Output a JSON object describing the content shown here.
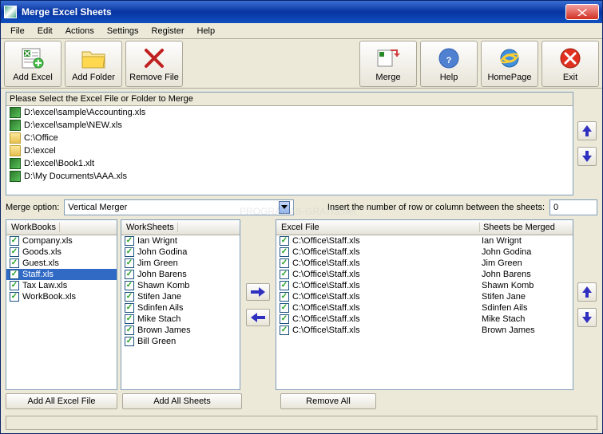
{
  "window": {
    "title": "Merge Excel Sheets"
  },
  "menu": {
    "file": "File",
    "edit": "Edit",
    "actions": "Actions",
    "settings": "Settings",
    "register": "Register",
    "help": "Help"
  },
  "toolbar": {
    "add_excel": "Add Excel",
    "add_folder": "Add Folder",
    "remove_file": "Remove File",
    "merge": "Merge",
    "help": "Help",
    "homepage": "HomePage",
    "exit": "Exit"
  },
  "filelist": {
    "header": "Please Select the Excel File or Folder to Merge",
    "items": [
      {
        "type": "excel",
        "path": "D:\\excel\\sample\\Accounting.xls"
      },
      {
        "type": "excel",
        "path": "D:\\excel\\sample\\NEW.xls"
      },
      {
        "type": "folder",
        "path": "C:\\Office"
      },
      {
        "type": "folder",
        "path": "D:\\excel"
      },
      {
        "type": "excel",
        "path": "D:\\excel\\Book1.xlt"
      },
      {
        "type": "excel",
        "path": "D:\\My Documents\\AAA.xls"
      }
    ]
  },
  "options": {
    "merge_option_label": "Merge option:",
    "merge_option_value": "Vertical Merger",
    "insert_label": "Insert the number of row or column between the sheets:",
    "insert_value": "0"
  },
  "workbooks": {
    "header": "WorkBooks",
    "items": [
      {
        "name": "Company.xls",
        "checked": true
      },
      {
        "name": "Goods.xls",
        "checked": true
      },
      {
        "name": "Guest.xls",
        "checked": true
      },
      {
        "name": "Staff.xls",
        "checked": true,
        "selected": true
      },
      {
        "name": "Tax Law.xls",
        "checked": true
      },
      {
        "name": "WorkBook.xls",
        "checked": true
      }
    ]
  },
  "worksheets": {
    "header": "WorkSheets",
    "items": [
      {
        "name": "Ian Wrignt",
        "checked": true
      },
      {
        "name": "John Godina",
        "checked": true
      },
      {
        "name": "Jim Green",
        "checked": true
      },
      {
        "name": "John Barens",
        "checked": true
      },
      {
        "name": "Shawn Komb",
        "checked": true
      },
      {
        "name": "Stifen Jane",
        "checked": true
      },
      {
        "name": "Sdinfen Ails",
        "checked": true
      },
      {
        "name": "Mike Stach",
        "checked": true
      },
      {
        "name": "Brown James",
        "checked": true
      },
      {
        "name": "Bill Green",
        "checked": true
      }
    ]
  },
  "result": {
    "col1": "Excel File",
    "col2": "Sheets be Merged",
    "rows": [
      {
        "file": "C:\\Office\\Staff.xls",
        "sheet": "Ian Wrignt"
      },
      {
        "file": "C:\\Office\\Staff.xls",
        "sheet": "John Godina"
      },
      {
        "file": "C:\\Office\\Staff.xls",
        "sheet": "Jim Green"
      },
      {
        "file": "C:\\Office\\Staff.xls",
        "sheet": "John Barens"
      },
      {
        "file": "C:\\Office\\Staff.xls",
        "sheet": "Shawn Komb"
      },
      {
        "file": "C:\\Office\\Staff.xls",
        "sheet": "Stifen Jane"
      },
      {
        "file": "C:\\Office\\Staff.xls",
        "sheet": "Sdinfen Ails"
      },
      {
        "file": "C:\\Office\\Staff.xls",
        "sheet": "Mike Stach"
      },
      {
        "file": "C:\\Office\\Staff.xls",
        "sheet": "Brown James"
      }
    ]
  },
  "buttons": {
    "add_all_excel": "Add All Excel File",
    "add_all_sheets": "Add All Sheets",
    "remove_all": "Remove All"
  },
  "watermark": "PROGRAMAS-GRATIS.net"
}
